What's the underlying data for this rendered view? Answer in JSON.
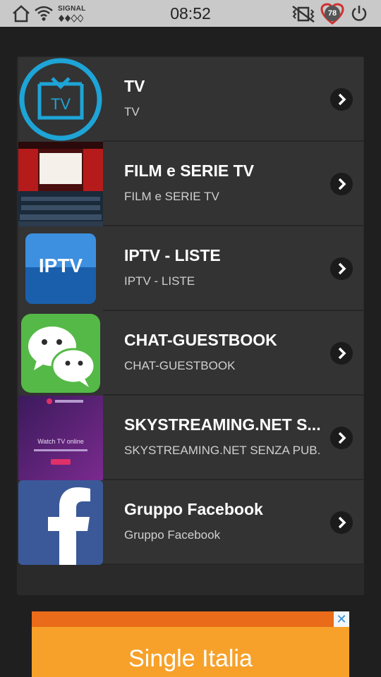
{
  "status_bar": {
    "time": "08:52",
    "signal_label": "SIGNAL",
    "battery_badge": "78",
    "icons": [
      "home-icon",
      "wifi-icon",
      "signal-dots-icon",
      "vibrate-icon",
      "heart-icon",
      "power-icon"
    ]
  },
  "list": {
    "items": [
      {
        "title": "TV",
        "subtitle": "TV",
        "thumb": "tv-logo-icon"
      },
      {
        "title": "FILM e SERIE TV",
        "subtitle": "FILM e SERIE TV",
        "thumb": "cinema-image"
      },
      {
        "title": "IPTV - LISTE",
        "subtitle": "IPTV - LISTE",
        "thumb": "iptv-logo",
        "thumb_text": "IPTV"
      },
      {
        "title": "CHAT-GUESTBOOK",
        "subtitle": "CHAT-GUESTBOOK",
        "thumb": "wechat-icon"
      },
      {
        "title": "SKYSTREAMING.NET S...",
        "subtitle": "SKYSTREAMING.NET SENZA PUB.",
        "thumb": "skystreaming-image",
        "thumb_text": "Watch TV online"
      },
      {
        "title": "Gruppo Facebook",
        "subtitle": "Gruppo Facebook",
        "thumb": "facebook-logo"
      }
    ]
  },
  "ad": {
    "text": "Single Italia",
    "close": "✕"
  },
  "colors": {
    "status_bar_bg": "#c9c9c9",
    "list_item_bg": "#333333",
    "tv_logo": "#1ea4d6",
    "iptv_blue": "#1f6fc4",
    "wechat_green": "#55b947",
    "facebook_blue": "#3b5998",
    "ad_orange": "#f7a12a"
  }
}
